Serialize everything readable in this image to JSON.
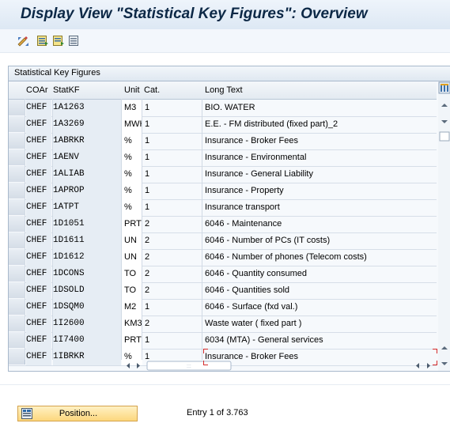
{
  "title": "Display View \"Statistical Key Figures\": Overview",
  "toolbar": {
    "icons": [
      "edit-display-toggle-icon",
      "select-all-icon",
      "select-block-icon",
      "deselect-all-icon"
    ]
  },
  "panel": {
    "title": "Statistical Key Figures"
  },
  "table": {
    "headers": [
      "COAr",
      "StatKF",
      "Unit",
      "Cat.",
      "Long Text"
    ],
    "rows": [
      [
        "CHEF",
        "1A1263",
        "M3",
        "1",
        "BIO. WATER"
      ],
      [
        "CHEF",
        "1A3269",
        "MWH",
        "1",
        "E.E. - FM distributed  (fixed part)_2"
      ],
      [
        "CHEF",
        "1ABRKR",
        "%",
        "1",
        "Insurance - Broker Fees"
      ],
      [
        "CHEF",
        "1AENV",
        "%",
        "1",
        "Insurance - Environmental"
      ],
      [
        "CHEF",
        "1ALIAB",
        "%",
        "1",
        "Insurance - General Liability"
      ],
      [
        "CHEF",
        "1APROP",
        "%",
        "1",
        "Insurance - Property"
      ],
      [
        "CHEF",
        "1ATPT",
        "%",
        "1",
        "Insurance transport"
      ],
      [
        "CHEF",
        "1D1051",
        "PRT",
        "2",
        "6046 - Maintenance"
      ],
      [
        "CHEF",
        "1D1611",
        "UN",
        "2",
        "6046 - Number of PCs (IT costs)"
      ],
      [
        "CHEF",
        "1D1612",
        "UN",
        "2",
        "6046 - Number of phones (Telecom costs)"
      ],
      [
        "CHEF",
        "1DCONS",
        "TO",
        "2",
        "6046 - Quantity consumed"
      ],
      [
        "CHEF",
        "1DSOLD",
        "TO",
        "2",
        "6046 - Quantities sold"
      ],
      [
        "CHEF",
        "1DSQM0",
        "M2",
        "1",
        "6046 - Surface (fxd val.)"
      ],
      [
        "CHEF",
        "1I2600",
        "KM3",
        "2",
        "Waste water ( fixed part )"
      ],
      [
        "CHEF",
        "1I7400",
        "PRT",
        "1",
        "6034 (MTA) - General services"
      ],
      [
        "CHEF",
        "1IBRKR",
        "%",
        "1",
        "Insurance - Broker Fees"
      ]
    ]
  },
  "footer": {
    "position_button": "Position...",
    "entry_info": "Entry 1 of 3.763"
  },
  "colors": {
    "title": "#0c2846",
    "button_bg": "#fcd77d",
    "grid_border": "#a9b9cc"
  }
}
